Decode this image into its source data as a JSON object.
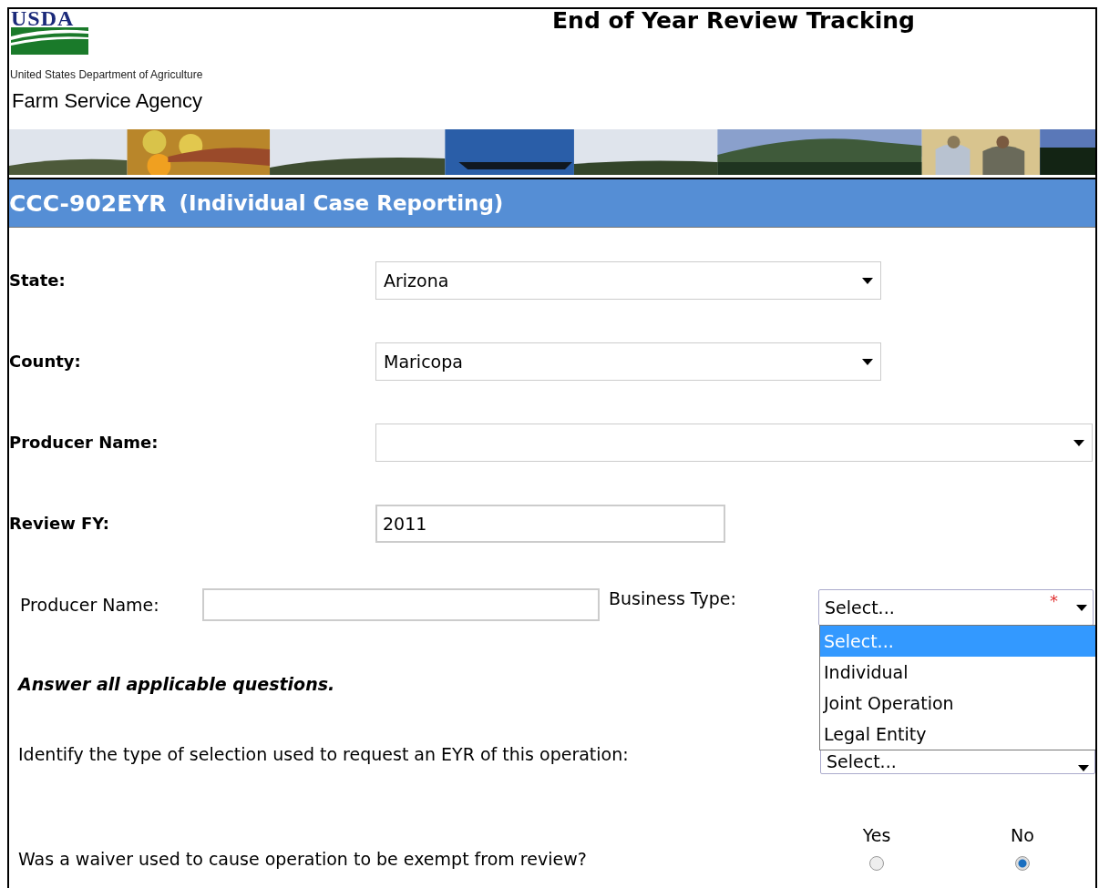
{
  "header": {
    "logo_text": "USDA",
    "department": "United States Department of Agriculture",
    "agency": "Farm Service Agency",
    "title": "End of Year Review Tracking"
  },
  "form_title": {
    "code": "CCC-902EYR",
    "subtitle": "(Individual Case Reporting)"
  },
  "fields": [
    {
      "label": "State:",
      "kind": "select",
      "value": "Arizona"
    },
    {
      "label": "County:",
      "kind": "select",
      "value": "Maricopa"
    },
    {
      "label": "Producer Name:",
      "kind": "wideselect"
    },
    {
      "label": "Review FY:",
      "kind": "text",
      "value": "2011"
    }
  ],
  "producer_row": {
    "producer_label": "Producer Name:",
    "business_label": "Business Type:",
    "business_value": "Select...",
    "required_mark": "*",
    "expanded": true,
    "options": [
      {
        "label": "Select...",
        "selected": true
      },
      {
        "label": "Individual",
        "selected": false
      },
      {
        "label": "Joint Operation",
        "selected": false
      },
      {
        "label": "Legal Entity",
        "selected": false
      }
    ]
  },
  "instructions": "Answer all applicable questions.",
  "selection_question": {
    "label": "Identify the type of selection used to request an EYR of this operation:",
    "value": "Select..."
  },
  "waiver_question": {
    "label": "Was a waiver used to cause operation to be exempt from review?",
    "options": [
      {
        "label": "Yes",
        "selected": false
      },
      {
        "label": "No",
        "selected": true
      }
    ]
  }
}
